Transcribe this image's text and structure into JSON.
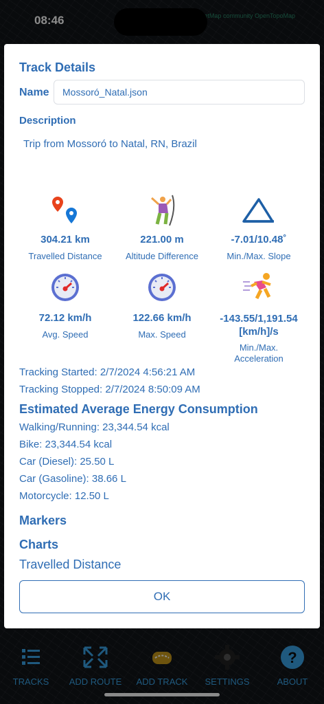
{
  "status": {
    "time": "08:46",
    "attribution": "OpenStreetMap community OpenTopoMap"
  },
  "dialog": {
    "title": "Track Details",
    "name_label": "Name",
    "name_value": "Mossoró_Natal.json",
    "description_label": "Description",
    "description_text": "Trip from Mossoró to Natal, RN, Brazil",
    "stats": [
      {
        "icon": "map-pins-icon",
        "value": "304.21 km",
        "label": "Travelled Distance"
      },
      {
        "icon": "climber-icon",
        "value": "221.00 m",
        "label": "Altitude Difference"
      },
      {
        "icon": "slope-triangle-icon",
        "value": "-7.01/10.48˚",
        "label": "Min./Max. Slope"
      },
      {
        "icon": "speedometer-icon",
        "value": "72.12 km/h",
        "label": "Avg. Speed"
      },
      {
        "icon": "speedometer-icon",
        "value": "122.66 km/h",
        "label": "Max. Speed"
      },
      {
        "icon": "runner-icon",
        "value": "-143.55/1,191.54\n[km/h]/s",
        "label": "Min./Max.\nAcceleration"
      }
    ],
    "tracking_started": "Tracking Started: 2/7/2024 4:56:21 AM",
    "tracking_stopped": "Tracking Stopped: 2/7/2024 8:50:09 AM",
    "energy_title": "Estimated Average Energy Consumption",
    "energy": [
      "Walking/Running: 23,344.54 kcal",
      "Bike: 23,344.54 kcal",
      "Car (Diesel): 25.50 L",
      "Car (Gasoline): 38.66 L",
      "Motorcycle: 12.50 L"
    ],
    "markers_title": "Markers",
    "charts_title": "Charts",
    "chart_name": "Travelled Distance",
    "ok_label": "OK"
  },
  "tabbar": [
    {
      "label": "TRACKS",
      "icon": "list-icon"
    },
    {
      "label": "ADD ROUTE",
      "icon": "route-arrows-icon"
    },
    {
      "label": "ADD TRACK",
      "icon": "track-icon"
    },
    {
      "label": "SETTINGS",
      "icon": "gear-icon"
    },
    {
      "label": "ABOUT",
      "icon": "help-icon"
    }
  ],
  "colors": {
    "accent": "#2f6db4",
    "tab_accent": "#3aa3e6",
    "dialog_bg": "#ffffff"
  }
}
